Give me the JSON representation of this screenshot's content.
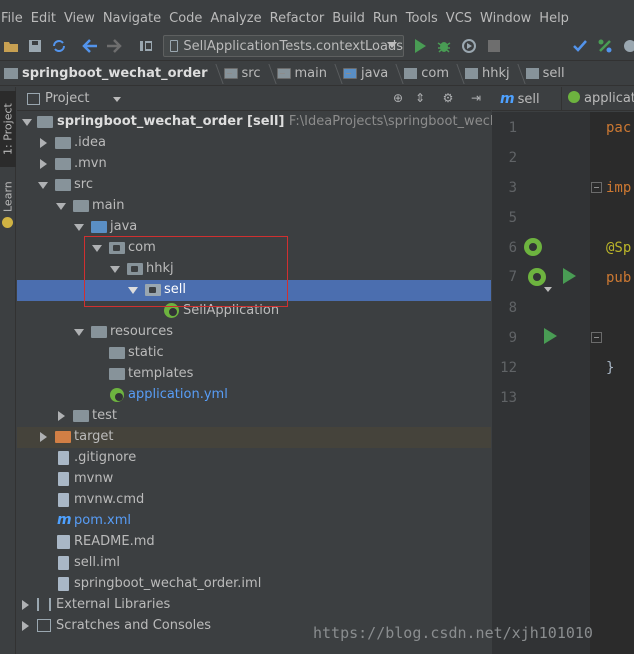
{
  "menu": [
    "File",
    "Edit",
    "View",
    "Navigate",
    "Code",
    "Analyze",
    "Refactor",
    "Build",
    "Run",
    "Tools",
    "VCS",
    "Window",
    "Help"
  ],
  "toolbar": {
    "run_config": "SellApplicationTests.contextLoads"
  },
  "breadcrumb": [
    "springboot_wechat_order",
    "src",
    "main",
    "java",
    "com",
    "hhkj",
    "sell"
  ],
  "left_strip": {
    "project_tab": "1: Project",
    "learn_tab": "Learn"
  },
  "panel": {
    "title": "Project"
  },
  "tree": {
    "root_name": "springboot_wechat_order [sell]",
    "root_path": "F:\\IdeaProjects\\springboot_wechat_order",
    "idea": ".idea",
    "mvn": ".mvn",
    "src": "src",
    "main": "main",
    "java": "java",
    "com": "com",
    "hhkj": "hhkj",
    "sell": "sell",
    "sell_application": "SellApplication",
    "resources": "resources",
    "static": "static",
    "templates": "templates",
    "application_yml": "application.yml",
    "test": "test",
    "target": "target",
    "gitignore": ".gitignore",
    "mvnw": "mvnw",
    "mvnw_cmd": "mvnw.cmd",
    "pom": "pom.xml",
    "readme": "README.md",
    "sell_iml": "sell.iml",
    "project_iml": "springboot_wechat_order.iml",
    "external_libraries": "External Libraries",
    "scratches": "Scratches and Consoles"
  },
  "editor_tabs": [
    "sell",
    "applicat"
  ],
  "editor": {
    "lines": [
      "1",
      "2",
      "3",
      "5",
      "6",
      "7",
      "8",
      "9",
      "12",
      "13"
    ],
    "code_pac": "pac",
    "code_imp": "imp",
    "code_ann": "@Sp",
    "code_pub": "pub",
    "code_brace": "}"
  },
  "watermark": "https://blog.csdn.net/xjh101010",
  "colors": {
    "selection": "#4b6eaf",
    "highlight_box": "#d03030",
    "link": "#589df6"
  }
}
